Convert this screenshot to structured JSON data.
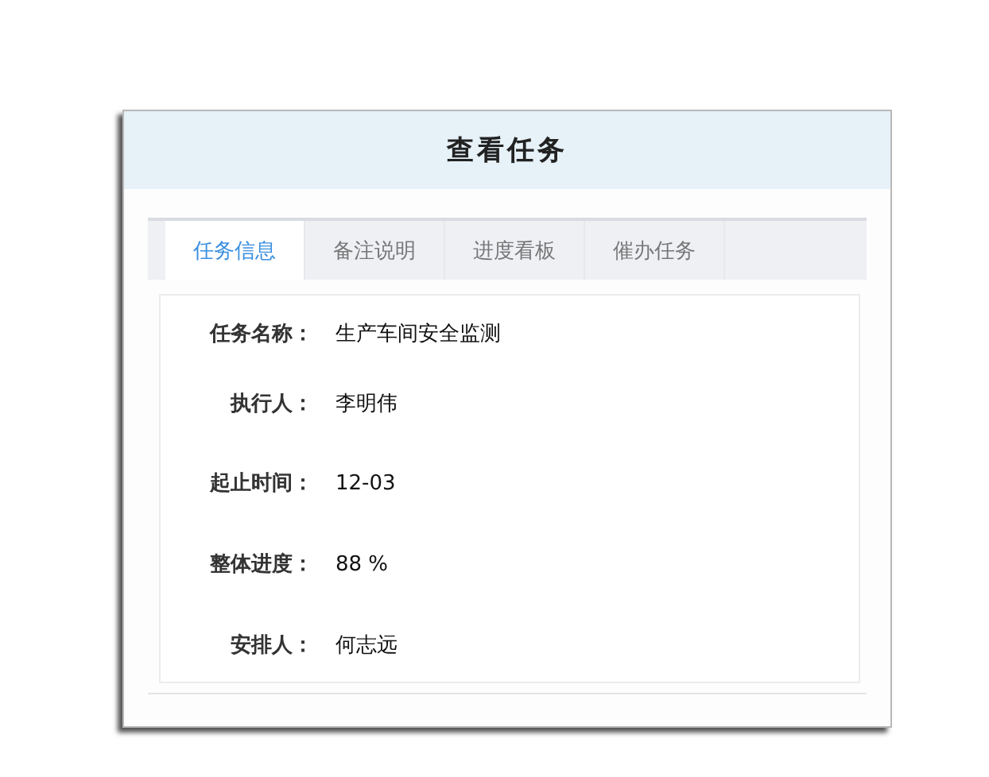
{
  "dialog": {
    "title": "查看任务"
  },
  "tabs": [
    {
      "label": "任务信息",
      "selected": true
    },
    {
      "label": "备注说明",
      "selected": false
    },
    {
      "label": "进度看板",
      "selected": false
    },
    {
      "label": "催办任务",
      "selected": false
    }
  ],
  "fields": [
    {
      "label": "任务名称：",
      "value": "生产车间安全监测"
    },
    {
      "label": "执行人：",
      "value": "李明伟"
    },
    {
      "label": "起止时间：",
      "value": "12-03"
    },
    {
      "label": "整体进度：",
      "value": "88 %"
    },
    {
      "label": "安排人：",
      "value": "何志远"
    }
  ]
}
